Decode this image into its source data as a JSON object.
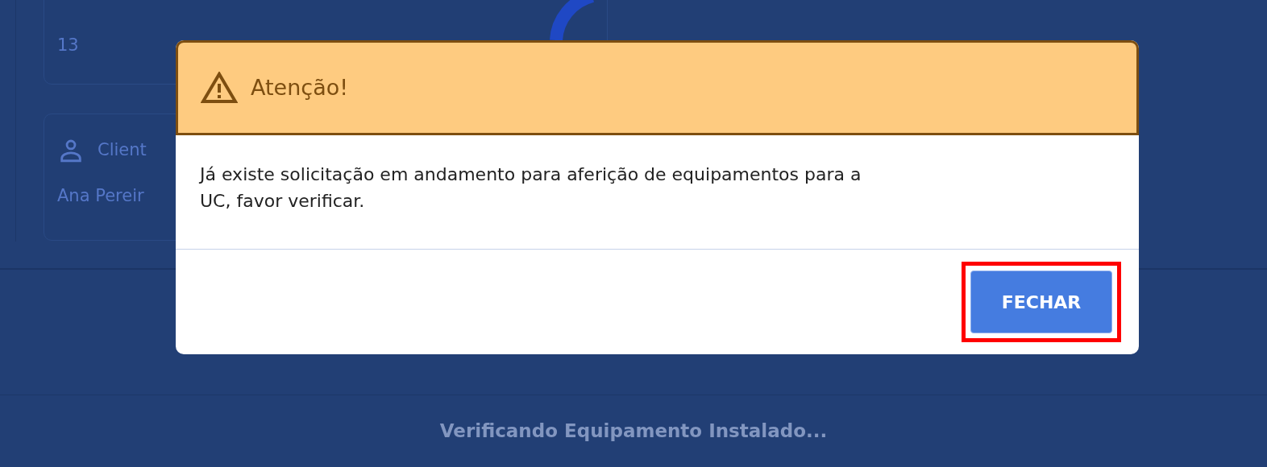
{
  "background": {
    "cards": [
      {
        "kind": "number",
        "value": "13"
      },
      {
        "kind": "person",
        "label": "Client",
        "value": "Ana Pereir"
      }
    ],
    "status_text": "Verificando Equipamento Instalado..."
  },
  "dialog": {
    "title": "Atenção!",
    "message": "Já existe solicitação em andamento para aferição de equipamentos para a UC, favor verificar.",
    "button": {
      "label": "FECHAR",
      "highlighted": true
    }
  }
}
